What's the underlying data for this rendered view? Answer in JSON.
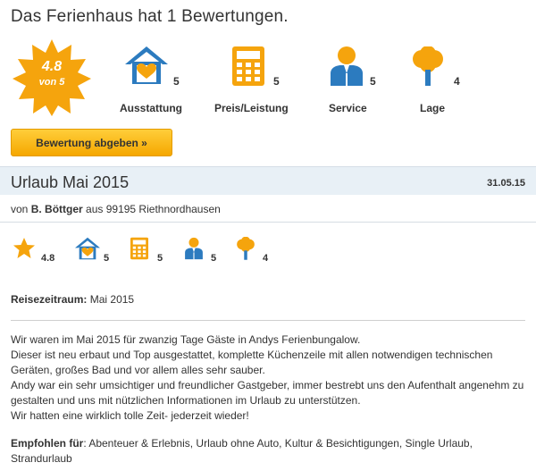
{
  "page_title": "Das Ferienhaus hat 1 Bewertungen.",
  "overall": {
    "score": "4.8",
    "suffix": "von 5",
    "badge_color": "#f5a40d"
  },
  "categories": [
    {
      "label": "Ausstattung",
      "value": "5",
      "icon": "house-heart-icon"
    },
    {
      "label": "Preis/Leistung",
      "value": "5",
      "icon": "calculator-icon"
    },
    {
      "label": "Service",
      "value": "5",
      "icon": "person-icon"
    },
    {
      "label": "Lage",
      "value": "4",
      "icon": "tree-icon"
    }
  ],
  "review_button": "Bewertung abgeben »",
  "review": {
    "title": "Urlaub Mai 2015",
    "date": "31.05.15",
    "author_prefix": "von",
    "author_name": "B. Böttger",
    "author_suffix": "aus 99195 Riethnordhausen",
    "ratings": [
      {
        "icon": "star-icon",
        "value": "4.8"
      },
      {
        "icon": "house-heart-icon",
        "value": "5"
      },
      {
        "icon": "calculator-icon",
        "value": "5"
      },
      {
        "icon": "person-icon",
        "value": "5"
      },
      {
        "icon": "tree-icon",
        "value": "4"
      }
    ],
    "reisezeitraum_label": "Reisezeitraum:",
    "reisezeitraum_value": "Mai 2015",
    "text_lines": [
      "Wir waren im Mai 2015 für zwanzig Tage Gäste in Andys Ferienbungalow.",
      "Dieser ist neu erbaut und Top ausgestattet, komplette Küchenzeile mit allen notwendigen technischen Geräten, großes Bad und vor allem alles sehr sauber.",
      "Andy war ein sehr umsichtiger und freundlicher Gastgeber, immer bestrebt uns den Aufenthalt angenehm zu gestalten und uns mit nützlichen Informationen im Urlaub zu unterstützen.",
      "Wir hatten eine wirklich tolle Zeit- jederzeit wieder!"
    ],
    "empfohlen_label": "Empfohlen für",
    "empfohlen_value": ": Abenteuer & Erlebnis, Urlaub ohne Auto, Kultur & Besichtigungen, Single Urlaub, Strandurlaub"
  },
  "colors": {
    "icon_orange": "#f5a40d",
    "icon_blue": "#2c7bbf",
    "header_bg": "#e8f0f6"
  }
}
